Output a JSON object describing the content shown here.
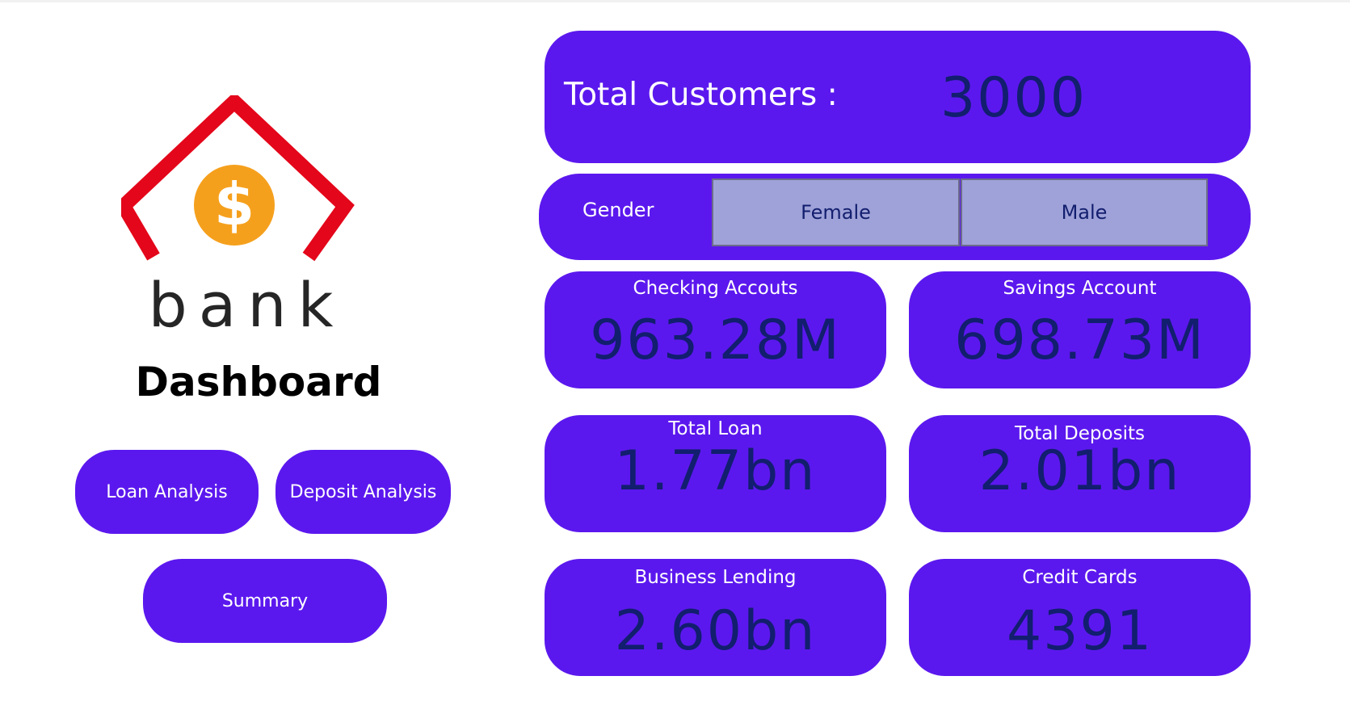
{
  "brand": {
    "logo_text": "bank",
    "currency_symbol": "$",
    "dashboard_title": "Dashboard",
    "colors": {
      "roof": "#e4061a",
      "coin": "#f5a01d",
      "card": "#5b18ee",
      "value": "#121e6e"
    }
  },
  "nav": {
    "loan_analysis": "Loan Analysis",
    "deposit_analysis": "Deposit Analysis",
    "summary": "Summary"
  },
  "total_customers": {
    "label": "Total Customers :",
    "value": "3000"
  },
  "gender_slicer": {
    "label": "Gender",
    "options": [
      "Female",
      "Male"
    ]
  },
  "kpis": {
    "checking": {
      "label": "Checking Accouts",
      "value": "963.28M"
    },
    "savings": {
      "label": "Savings Account",
      "value": "698.73M"
    },
    "loan": {
      "label": "Total Loan",
      "value": "1.77bn"
    },
    "deposits": {
      "label": "Total Deposits",
      "value": "2.01bn"
    },
    "business_lending": {
      "label": "Business Lending",
      "value": "2.60bn"
    },
    "credit_cards": {
      "label": "Credit Cards",
      "value": "4391"
    }
  }
}
